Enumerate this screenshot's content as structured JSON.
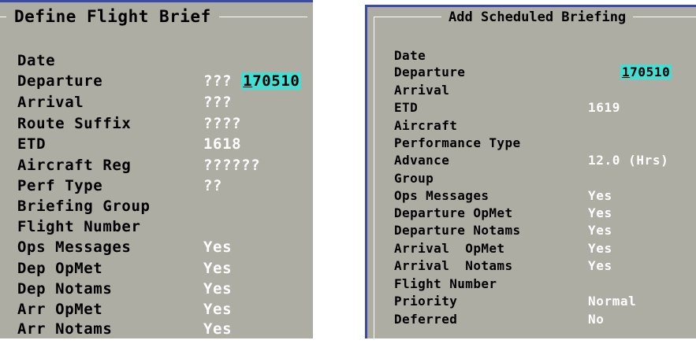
{
  "left_panel": {
    "title": "Define Flight Brief",
    "date_value": "170510",
    "fields": [
      {
        "label": "Date",
        "value": ""
      },
      {
        "label": "Departure",
        "value": "???"
      },
      {
        "label": "Arrival",
        "value": "???"
      },
      {
        "label": "Route Suffix",
        "value": "????"
      },
      {
        "label": "ETD",
        "value": "1618"
      },
      {
        "label": "Aircraft Reg",
        "value": "??????"
      },
      {
        "label": "Perf Type",
        "value": "??"
      },
      {
        "label": "Briefing Group",
        "value": ""
      },
      {
        "label": "Flight Number",
        "value": ""
      },
      {
        "label": "Ops Messages",
        "value": "Yes"
      },
      {
        "label": "Dep OpMet",
        "value": "Yes"
      },
      {
        "label": "Dep Notams",
        "value": "Yes"
      },
      {
        "label": "Arr OpMet",
        "value": "Yes"
      },
      {
        "label": "Arr Notams",
        "value": "Yes"
      }
    ]
  },
  "right_panel": {
    "title": "Add Scheduled Briefing",
    "date_value": "170510",
    "fields": [
      {
        "label": "Date",
        "value": ""
      },
      {
        "label": "Departure",
        "value": ""
      },
      {
        "label": "Arrival",
        "value": ""
      },
      {
        "label": "ETD",
        "value": "1619"
      },
      {
        "label": "Aircraft",
        "value": ""
      },
      {
        "label": "Performance Type",
        "value": ""
      },
      {
        "label": "Advance",
        "value": "12.0 (Hrs)"
      },
      {
        "label": "Group",
        "value": ""
      },
      {
        "label": "Ops Messages",
        "value": "Yes"
      },
      {
        "label": "Departure OpMet",
        "value": "Yes"
      },
      {
        "label": "Departure Notams",
        "value": "Yes"
      },
      {
        "label": "Arrival  OpMet",
        "value": "Yes"
      },
      {
        "label": "Arrival  Notams",
        "value": "Yes"
      },
      {
        "label": "Flight Number",
        "value": ""
      },
      {
        "label": "Priority",
        "value": "Normal"
      },
      {
        "label": "Deferred",
        "value": "No"
      }
    ]
  }
}
